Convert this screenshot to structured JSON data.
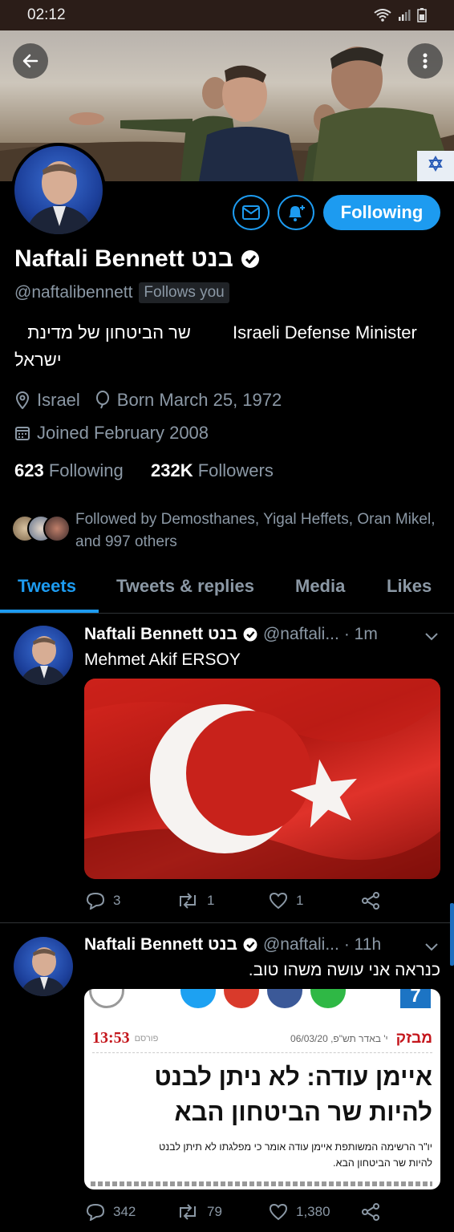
{
  "status_bar": {
    "time": "02:12"
  },
  "profile": {
    "name": "Naftali Bennett בנט",
    "handle": "@naftalibennett",
    "follows_you": "Follows you",
    "bio_he_line1": "שר הביטחון של מדינת",
    "bio_he_line2": "ישראל",
    "bio_en": "Israeli Defense Minister",
    "location": "Israel",
    "born": "Born March 25, 1972",
    "joined": "Joined February 2008",
    "following_count": "623",
    "following_label": "Following",
    "followers_count": "232K",
    "followers_label": "Followers",
    "followed_by": "Followed by Demosthanes, Yigal Heffets, Oran Mikel, and 997 others",
    "follow_button": "Following"
  },
  "tabs": [
    {
      "label": "Tweets",
      "active": true
    },
    {
      "label": "Tweets & replies",
      "active": false
    },
    {
      "label": "Media",
      "active": false
    },
    {
      "label": "Likes",
      "active": false
    }
  ],
  "tweets": [
    {
      "name": "Naftali Bennett בנט",
      "handle": "@naftali...",
      "time": "· 1m",
      "text": "Mehmet Akif ERSOY",
      "replies": "3",
      "retweets": "1",
      "likes": "1"
    },
    {
      "name": "Naftali Bennett בנט",
      "handle": "@naftali...",
      "time": "· 11h",
      "text": "כנראה אני עושה משהו טוב.",
      "replies": "342",
      "retweets": "79",
      "likes": "1,380",
      "article": {
        "time": "13:53",
        "published": "פורסם",
        "date": "06/03/20 ,י' באדר תש\"פ",
        "tag": "מבזק",
        "headline1": "איימן עודה: לא ניתן לבנט",
        "headline2": "להיות שר הביטחון הבא",
        "body1": "יו\"ר הרשימה המשותפת איימן עודה אומר כי מפלגתו לא תיתן לבנט",
        "body2": "להיות שר הביטחון הבא."
      }
    }
  ],
  "colors": {
    "accent": "#1d9bf0",
    "background": "#000000",
    "muted": "#8b98a5"
  }
}
